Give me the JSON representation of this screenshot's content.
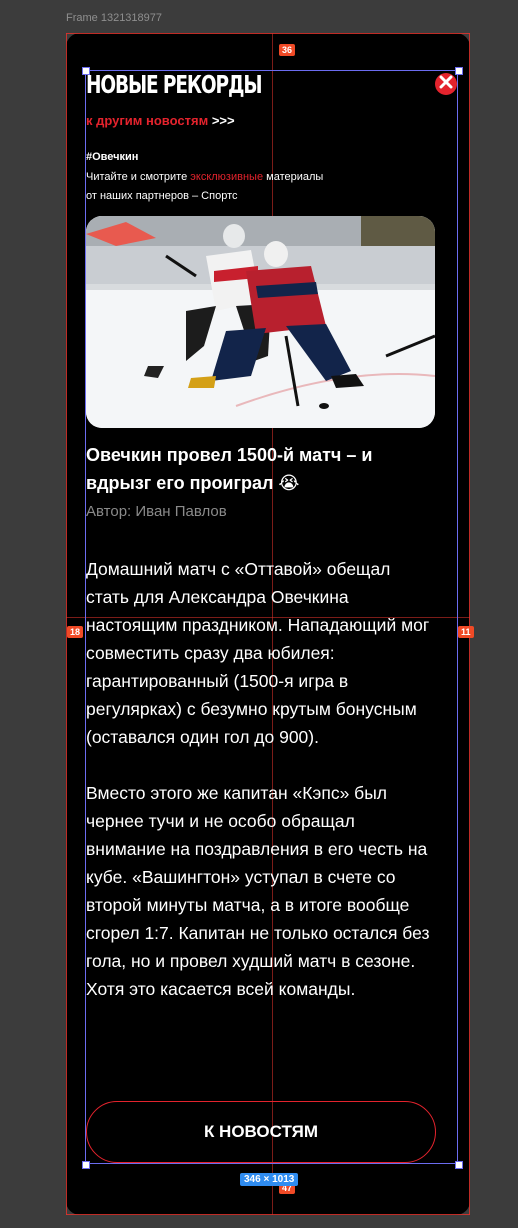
{
  "editor": {
    "frame_name": "Frame 1321318977",
    "measure_top": "36",
    "measure_left": "18",
    "measure_right": "11",
    "measure_bottom": "47",
    "selection_size": "346 × 1013"
  },
  "header": {
    "title": "НОВЫЕ РЕКОРДЫ",
    "back_link_text": "к другим новостям",
    "back_link_arrows": ">>>",
    "close_icon": "close-x-icon"
  },
  "promo": {
    "tag": "#Овечкин",
    "line_before": "Читайте и смотрите ",
    "accent_word": "эксклюзивные",
    "line_after": " материалы",
    "line2": "от наших партнеров – Спортс"
  },
  "article": {
    "headline": "Овечкин провел 1500-й матч – и вдрызг его проиграл 😭",
    "author": "Автор: Иван Павлов",
    "paragraphs": [
      "Домашний матч с «Оттавой» обещал стать для Александра Овечкина настоящим праздником. Нападающий мог совместить сразу два юбилея: гарантированный (1500-я игра в регулярках) с безумно крутым бонусным (оставался один гол до 900).",
      "Вместо этого же капитан «Кэпс» был чернее тучи и не особо обращал внимание на поздравления в его честь на кубе. «Вашингтон» уступал в счете со второй минуты матча, а в итоге вообще сгорел 1:7. Капитан не только остался без гола, но и провел худший матч в сезоне. Хотя это касается всей команды."
    ],
    "image_alt": "hockey-photo",
    "button_label": "К НОВОСТЯМ"
  },
  "colors": {
    "accent": "#e4232d",
    "background": "#000000",
    "canvas": "#3c3c3c",
    "guide": "#e0332c",
    "selection": "#6b6cf0"
  }
}
